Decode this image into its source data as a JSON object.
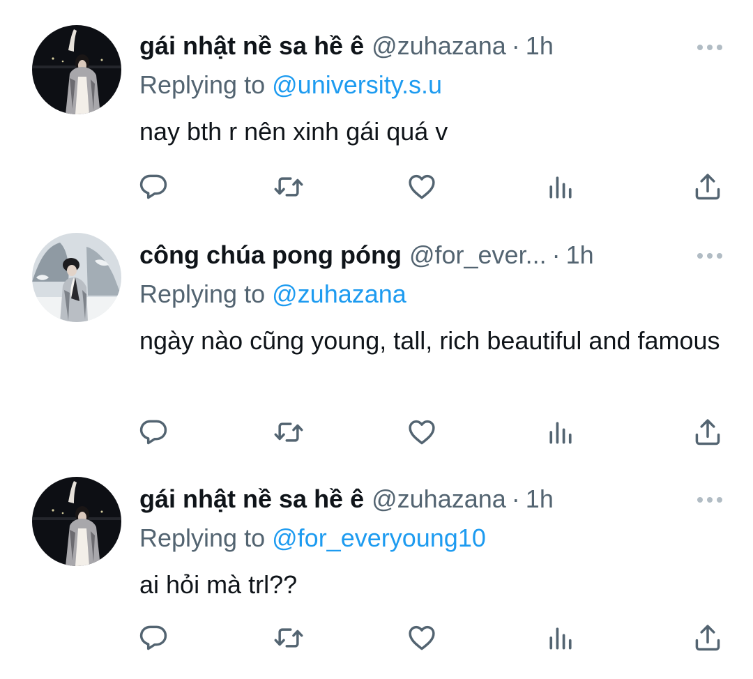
{
  "colors": {
    "text": "#0f1419",
    "secondary": "#536471",
    "link": "#1d9bf0",
    "icon": "#536471"
  },
  "tweets": [
    {
      "display_name": "gái nhật nề sa hề ê",
      "handle": "@zuhazana",
      "separator": "·",
      "time": "1h",
      "replying_prefix": "Replying to",
      "replying_to": "@university.s.u",
      "text": "nay bth r nên xinh gái quá v"
    },
    {
      "display_name": "công chúa pong póng",
      "handle": "@for_ever...",
      "separator": "·",
      "time": "1h",
      "replying_prefix": "Replying to",
      "replying_to": "@zuhazana",
      "text": "ngày nào cũng young, tall, rich beautiful and famous"
    },
    {
      "display_name": "gái nhật nề sa hề ê",
      "handle": "@zuhazana",
      "separator": "·",
      "time": "1h",
      "replying_prefix": "Replying to",
      "replying_to": "@for_everyoung10",
      "text": "ai hỏi mà trl??"
    }
  ],
  "actions": [
    "reply-icon",
    "retweet-icon",
    "like-icon",
    "views-icon",
    "share-icon"
  ]
}
